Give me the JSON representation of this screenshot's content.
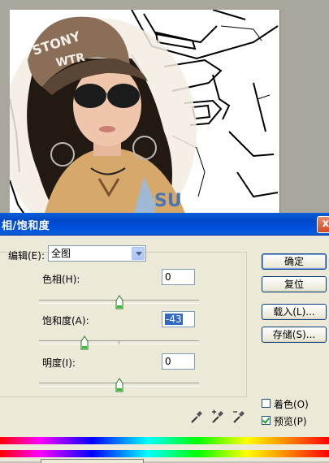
{
  "colors": {
    "title_bar": "#0a5fd8",
    "dialog_bg": "#ece9d8",
    "selection": "#316ac5",
    "check_green": "#21a121"
  },
  "photo": {
    "cap_text_1": "STONY",
    "cap_text_2": "WTR",
    "shirt_text": "SU"
  },
  "dialog": {
    "title": "相/饱和度",
    "close_label": "x",
    "edit_label": "编辑(E):",
    "edit_value": "全图",
    "hue_label": "色相(H):",
    "hue_value": "0",
    "saturation_label": "饱和度(A):",
    "saturation_value": "-43",
    "lightness_label": "明度(I):",
    "lightness_value": "0",
    "slider_levels": {
      "hue": 0,
      "saturation": -43,
      "lightness": 0
    },
    "buttons": {
      "ok": "确定",
      "reset": "复位",
      "load": "载入(L)...",
      "save": "存储(S)..."
    },
    "colorize_label": "着色(O)",
    "colorize_checked": false,
    "preview_label": "预览(P)",
    "preview_checked": true,
    "icons": [
      "eyedropper-icon",
      "eyedropper-plus-icon",
      "eyedropper-minus-icon"
    ]
  }
}
